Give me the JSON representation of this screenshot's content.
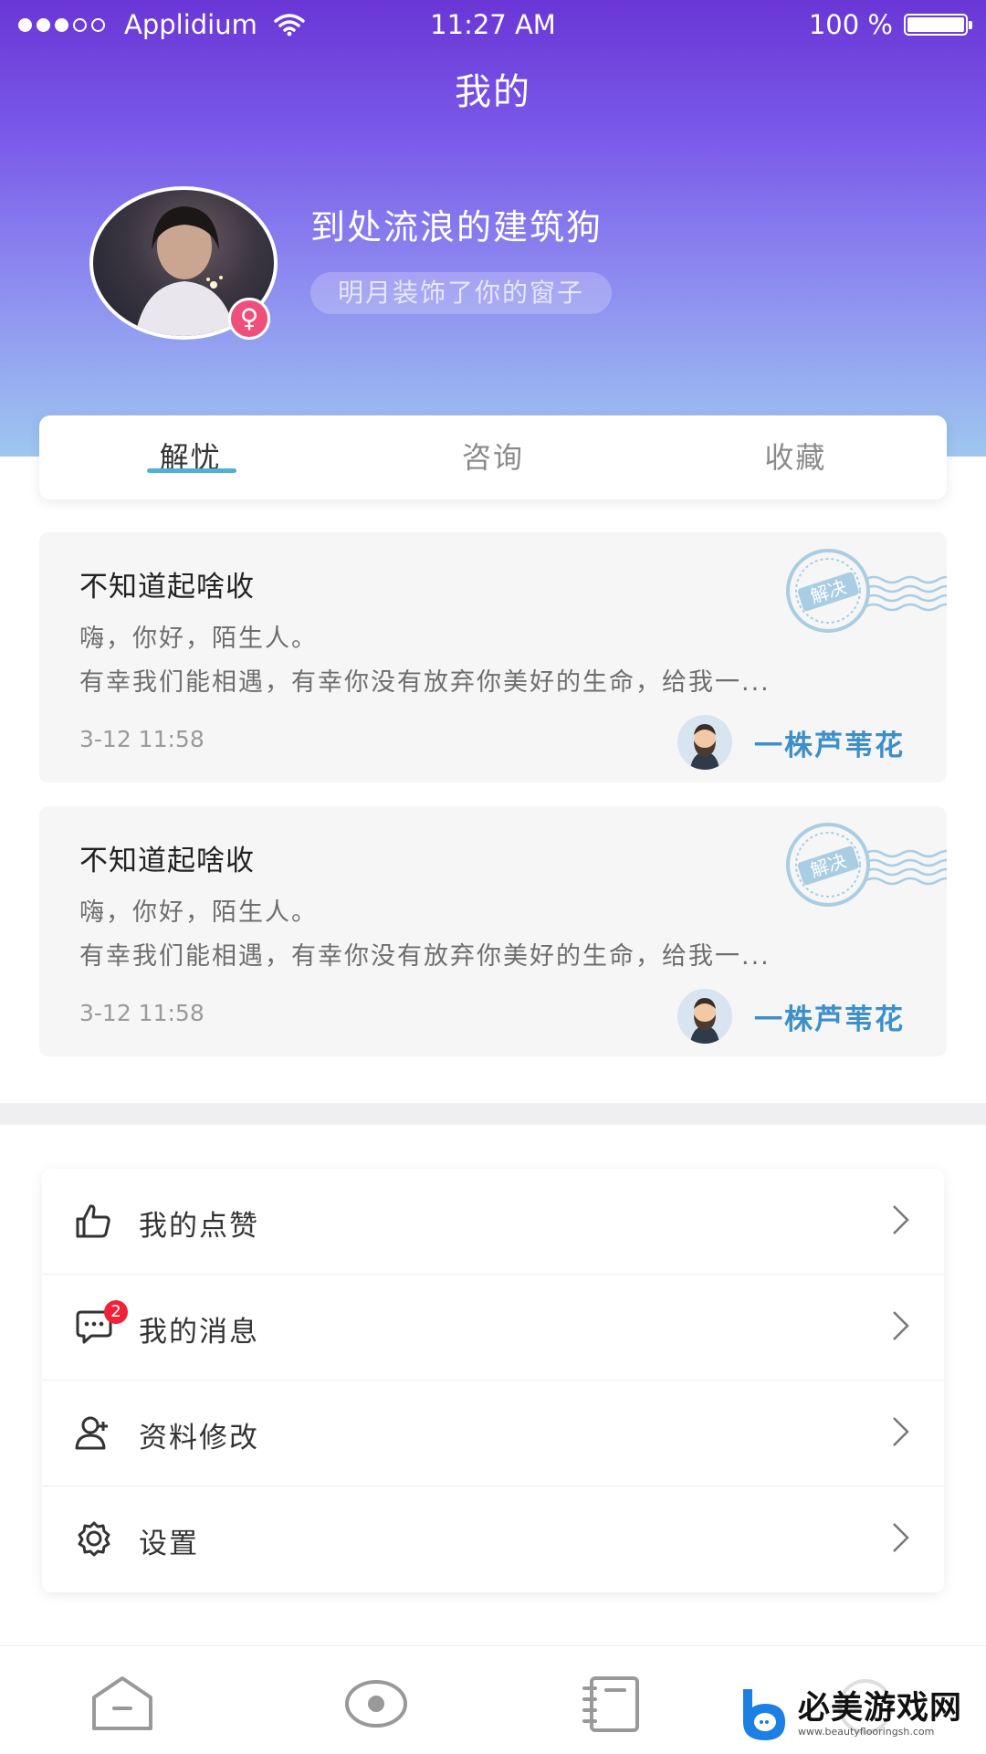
{
  "status_bar": {
    "carrier": "Applidium",
    "time": "11:27 AM",
    "battery": "100 %",
    "signal_bars": 3,
    "signal_total": 5
  },
  "header": {
    "title": "我的"
  },
  "profile": {
    "username": "到处流浪的建筑狗",
    "signature": "明月装饰了你的窗子",
    "gender_symbol": "♀"
  },
  "tabs": [
    {
      "label": "解忧",
      "active": true
    },
    {
      "label": "咨询",
      "active": false
    },
    {
      "label": "收藏",
      "active": false
    }
  ],
  "cards": [
    {
      "title": "不知道起啥收",
      "line1": "嗨，你好，陌生人。",
      "line2": "有幸我们能相遇，有幸你没有放弃你美好的生命，给我一...",
      "time": "3-12 11:58",
      "author": "一株芦苇花",
      "stamp": "解决"
    },
    {
      "title": "不知道起啥收",
      "line1": "嗨，你好，陌生人。",
      "line2": "有幸我们能相遇，有幸你没有放弃你美好的生命，给我一...",
      "time": "3-12 11:58",
      "author": "一株芦苇花",
      "stamp": "解决"
    }
  ],
  "menu": [
    {
      "label": "我的点赞",
      "icon": "thumbs-up-icon"
    },
    {
      "label": "我的消息",
      "icon": "message-icon",
      "badge": "2"
    },
    {
      "label": "资料修改",
      "icon": "user-edit-icon"
    },
    {
      "label": "设置",
      "icon": "gear-icon"
    }
  ],
  "bottom_nav": [
    {
      "icon": "home-icon"
    },
    {
      "icon": "eye-icon"
    },
    {
      "icon": "notebook-icon"
    },
    {
      "icon": "profile-icon"
    }
  ],
  "watermark": {
    "title": "必美游戏网",
    "url": "www.beautyflooringsh.com"
  },
  "colors": {
    "header_gradient_top": "#6a36d6",
    "header_gradient_bottom": "#9ec7ef",
    "accent_blue": "#3d8fca",
    "tab_underline": "#4fb1d6",
    "badge_red": "#f2213a",
    "gender_pink": "#ef4f7b"
  }
}
